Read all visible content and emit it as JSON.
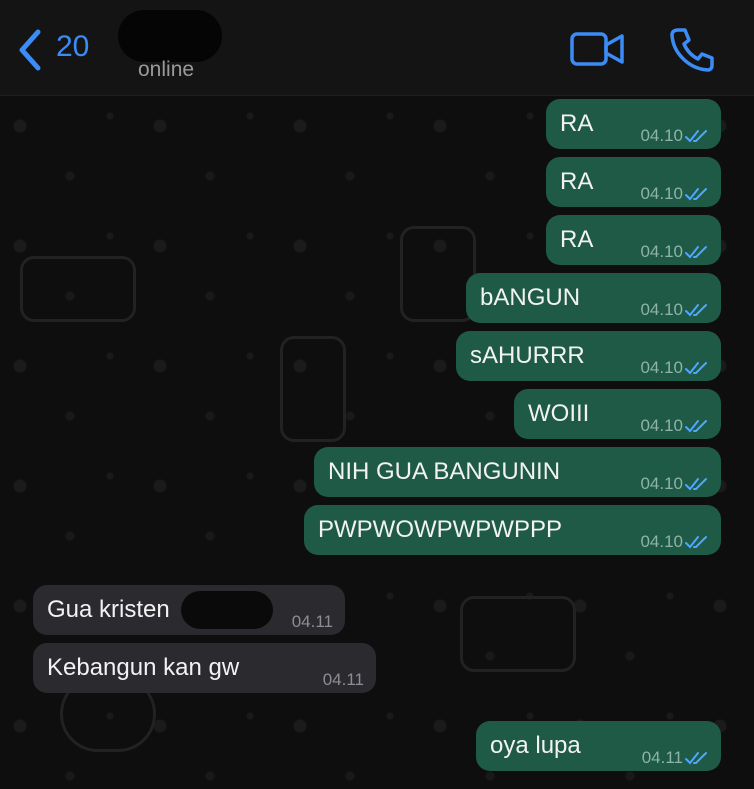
{
  "header": {
    "back_count": "20",
    "status": "online"
  },
  "messages": [
    {
      "text": "RA",
      "time": "04.10",
      "dir": "out"
    },
    {
      "text": "RA",
      "time": "04.10",
      "dir": "out"
    },
    {
      "text": "RA",
      "time": "04.10",
      "dir": "out"
    },
    {
      "text": "bANGUN",
      "time": "04.10",
      "dir": "out"
    },
    {
      "text": "sAHURRR",
      "time": "04.10",
      "dir": "out"
    },
    {
      "text": "WOIII",
      "time": "04.10",
      "dir": "out"
    },
    {
      "text": "NIH GUA BANGUNIN",
      "time": "04.10",
      "dir": "out"
    },
    {
      "text": "PWPWOWPWPWPPP",
      "time": "04.10",
      "dir": "out"
    },
    {
      "text": "Gua kristen",
      "time": "04.11",
      "dir": "in"
    },
    {
      "text": "Kebangun kan gw",
      "time": "04.11",
      "dir": "in"
    },
    {
      "text": "oya lupa",
      "time": "04.11",
      "dir": "out"
    }
  ],
  "colors": {
    "accent": "#3b8cf6",
    "outgoing_bubble": "#1e5a46",
    "incoming_bubble": "#2b2a2f",
    "read_ticks": "#4fa6ff"
  },
  "icons": {
    "back": "chevron-left-icon",
    "video": "video-camera-icon",
    "call": "phone-icon",
    "ticks": "double-check-icon"
  }
}
